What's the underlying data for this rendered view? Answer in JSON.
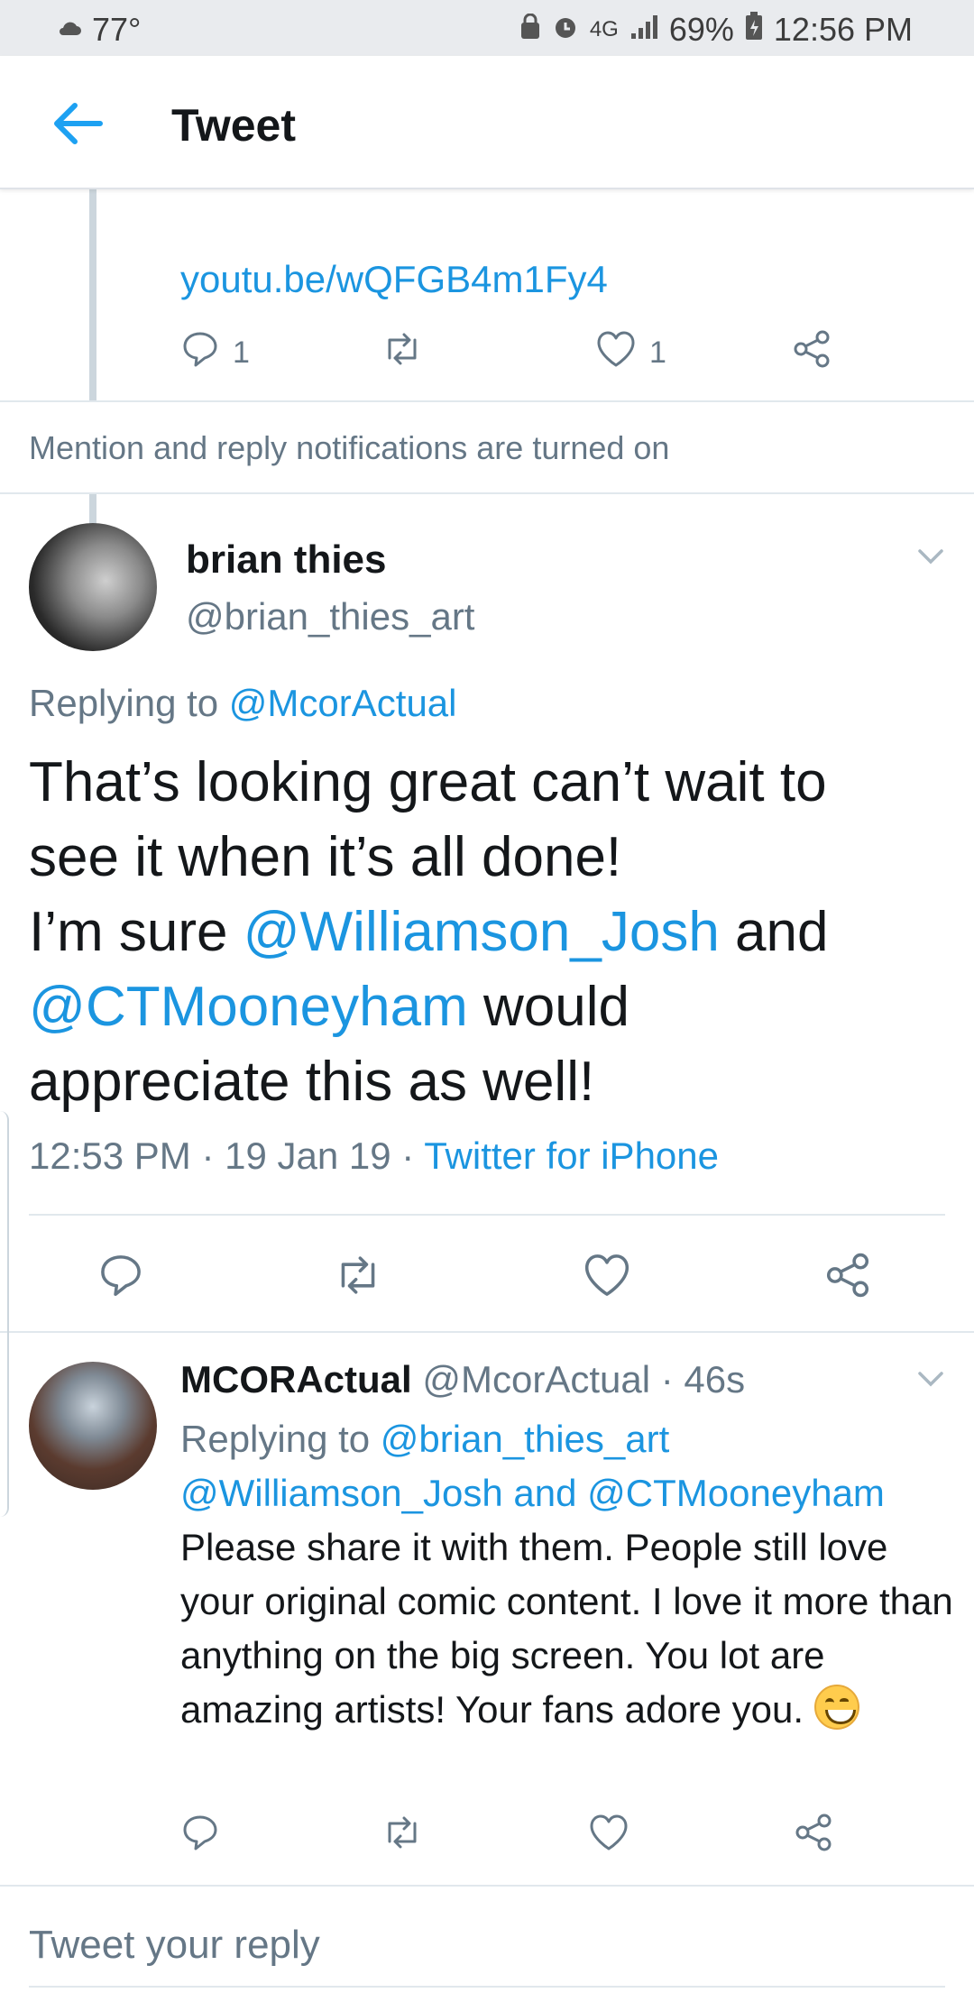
{
  "status_bar": {
    "temperature": "77°",
    "network": "4G",
    "battery": "69%",
    "time": "12:56 PM"
  },
  "app_bar": {
    "title": "Tweet"
  },
  "previous_tweet": {
    "link": "youtu.be/wQFGB4m1Fy4",
    "reply_count": "1",
    "like_count": "1"
  },
  "notice": "Mention and reply notifications are turned on",
  "main_tweet": {
    "name": "brian thies",
    "handle": "@brian_thies_art",
    "replying_label": "Replying to ",
    "replying_to": "@McorActual",
    "body": {
      "p1": "That’s looking great can’t wait to see it when it’s all done!",
      "p2_pre": "I’m sure ",
      "mention1": "@Williamson_Josh",
      "p2_mid": " and ",
      "mention2": "@CTMooneyham",
      "p2_post": " would appreciate this as well!"
    },
    "time": "12:53 PM",
    "date": "19 Jan 19",
    "source": "Twitter for iPhone"
  },
  "reply_tweet": {
    "name": "MCORActual",
    "handle": "@McorActual",
    "age": "46s",
    "replying_label": "Replying to ",
    "mention_a": "@brian_thies_art",
    "mention_b": "@Williamson_Josh",
    "and_text": " and ",
    "mention_c": "@CTMooneyham",
    "body": "Please share it with them. People still love your original comic content. I love it more than anything on the big screen. You lot are amazing artists! Your fans adore you."
  },
  "composer": {
    "placeholder": "Tweet your reply"
  },
  "colors": {
    "accent": "#1da1f2",
    "link": "#1b95e0",
    "muted": "#657786",
    "text": "#14171a"
  },
  "icons": [
    "back-arrow-icon",
    "reply-icon",
    "retweet-icon",
    "like-icon",
    "share-icon",
    "chevron-down-icon"
  ]
}
